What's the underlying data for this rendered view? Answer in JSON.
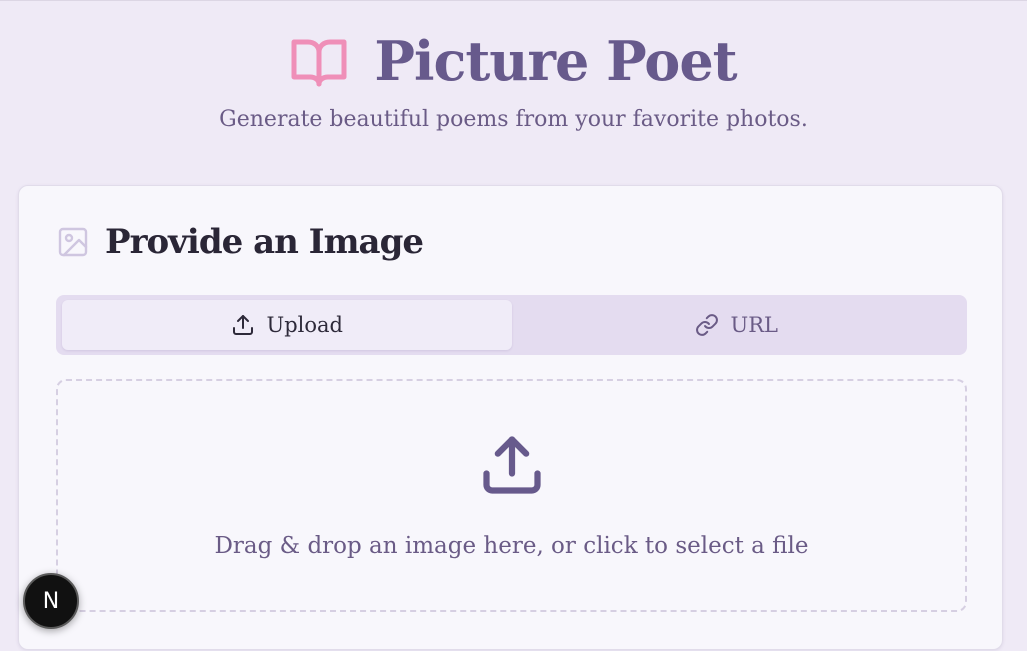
{
  "header": {
    "title": "Picture Poet",
    "subtitle": "Generate beautiful poems from your favorite photos.",
    "logo_icon": "book-open-icon"
  },
  "card": {
    "title": "Provide an Image",
    "title_icon": "image-icon",
    "tabs": [
      {
        "label": "Upload",
        "icon": "upload-icon",
        "active": true
      },
      {
        "label": "URL",
        "icon": "link-icon",
        "active": false
      }
    ],
    "dropzone": {
      "icon": "upload-icon",
      "text": "Drag & drop an image here, or click to select a file"
    }
  },
  "dev_badge": {
    "label": "N",
    "icon": "nextjs-icon"
  },
  "colors": {
    "background": "#efeaf6",
    "brand_primary": "#675a8c",
    "logo_pink": "#ef8fb8",
    "card_bg": "#f8f7fc",
    "tabs_bg": "#e4dcf0",
    "text_dark": "#2a2636"
  }
}
